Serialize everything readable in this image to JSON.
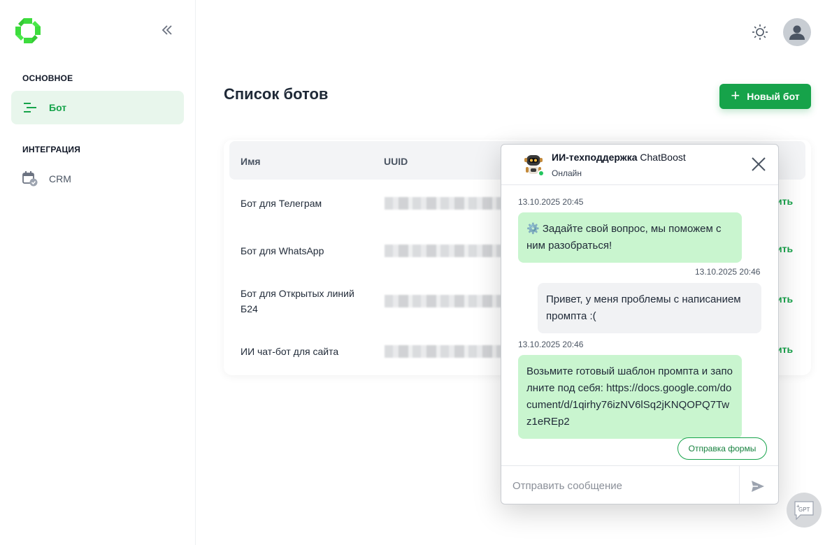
{
  "sidebar": {
    "sections": [
      {
        "label": "ОСНОВНОЕ"
      },
      {
        "label": "ИНТЕГРАЦИЯ"
      }
    ],
    "items": [
      {
        "label": "Бот",
        "icon": "bot-list-icon",
        "active": true
      },
      {
        "label": "CRM",
        "icon": "calendar-check-icon",
        "active": false
      }
    ]
  },
  "header": {
    "theme_icon": "sun-icon",
    "avatar_icon": "user-icon"
  },
  "main": {
    "title": "Список ботов",
    "new_bot_label": "Новый бот",
    "table": {
      "columns": [
        "Имя",
        "UUID"
      ],
      "rows": [
        {
          "name": "Бот для Телеграм",
          "action": "ить"
        },
        {
          "name": "Бот для WhatsApp",
          "action": "ить"
        },
        {
          "name": "Бот для Открытых линий Б24",
          "action": "ить"
        },
        {
          "name": "ИИ чат-бот для сайта",
          "action": "ить"
        }
      ]
    }
  },
  "chat": {
    "title_bold": "ИИ-техподдержка",
    "title_rest": "ChatBoost",
    "status": "Онлайн",
    "messages": [
      {
        "from": "bot",
        "time": "13.10.2025 20:45",
        "text": "⚙️ Задайте свой вопрос, мы поможем с ним разобраться!"
      },
      {
        "from": "user",
        "time": "13.10.2025 20:46",
        "text": "Привет, у меня проблемы с написанием промпта :("
      },
      {
        "from": "bot",
        "time": "13.10.2025 20:46",
        "text": "Возьмите готовый шаблон промпта и заполните под себя: https://docs.google.com/document/d/1qirhy76izNV6lSq2jKNQOPQ7Twz1eREp2"
      }
    ],
    "form_button": "Отправка формы",
    "input_placeholder": "Отправить сообщение"
  },
  "fab": {
    "label": "GPT"
  },
  "colors": {
    "accent": "#16a34a",
    "bot_bubble": "#c9f5cf",
    "user_bubble": "#f1f2f4"
  }
}
